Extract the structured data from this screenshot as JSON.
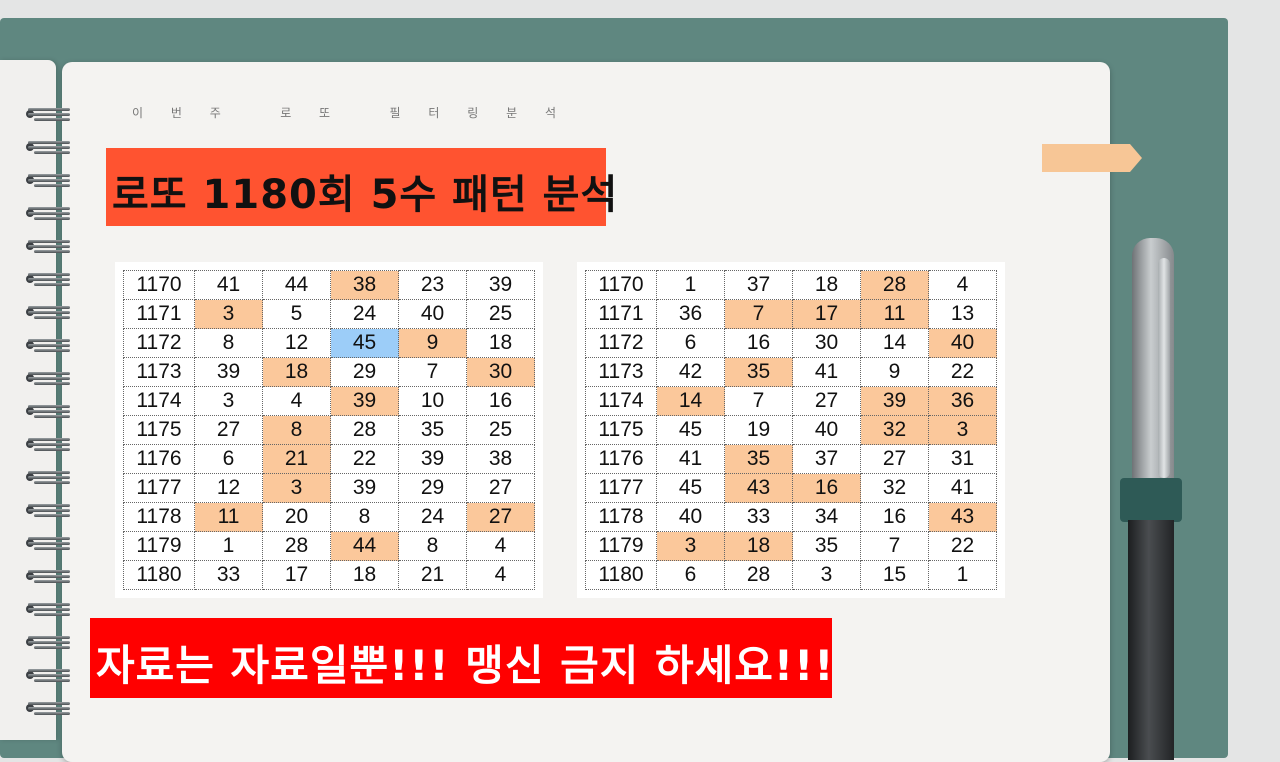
{
  "subtitle": "이 번 주   로 또   필 터 링 분 석",
  "title": "로또 1180회 5수 패턴 분석",
  "warning": "자료는 자료일뿐!!! 맹신 금지 하세요!!!",
  "colors": {
    "highlight": "#fbc89b",
    "blue_highlight": "#9ccdf8",
    "title_bg": "#ff5330",
    "warning_bg": "#ff0000"
  },
  "tables": [
    {
      "rows": [
        {
          "round": "1170",
          "nums": [
            "41",
            "44",
            "38",
            "23",
            "39"
          ],
          "hl": [
            2
          ]
        },
        {
          "round": "1171",
          "nums": [
            "3",
            "5",
            "24",
            "40",
            "25"
          ],
          "hl": [
            0
          ]
        },
        {
          "round": "1172",
          "nums": [
            "8",
            "12",
            "45",
            "9",
            "18"
          ],
          "hl": [
            3
          ],
          "blue": [
            2
          ]
        },
        {
          "round": "1173",
          "nums": [
            "39",
            "18",
            "29",
            "7",
            "30"
          ],
          "hl": [
            1,
            4
          ]
        },
        {
          "round": "1174",
          "nums": [
            "3",
            "4",
            "39",
            "10",
            "16"
          ],
          "hl": [
            2
          ]
        },
        {
          "round": "1175",
          "nums": [
            "27",
            "8",
            "28",
            "35",
            "25"
          ],
          "hl": [
            1
          ]
        },
        {
          "round": "1176",
          "nums": [
            "6",
            "21",
            "22",
            "39",
            "38"
          ],
          "hl": [
            1
          ]
        },
        {
          "round": "1177",
          "nums": [
            "12",
            "3",
            "39",
            "29",
            "27"
          ],
          "hl": [
            1
          ]
        },
        {
          "round": "1178",
          "nums": [
            "11",
            "20",
            "8",
            "24",
            "27"
          ],
          "hl": [
            0,
            4
          ]
        },
        {
          "round": "1179",
          "nums": [
            "1",
            "28",
            "44",
            "8",
            "4"
          ],
          "hl": [
            2
          ]
        },
        {
          "round": "1180",
          "nums": [
            "33",
            "17",
            "18",
            "21",
            "4"
          ],
          "hl": []
        }
      ]
    },
    {
      "rows": [
        {
          "round": "1170",
          "nums": [
            "1",
            "37",
            "18",
            "28",
            "4"
          ],
          "hl": [
            3
          ]
        },
        {
          "round": "1171",
          "nums": [
            "36",
            "7",
            "17",
            "11",
            "13"
          ],
          "hl": [
            1,
            2,
            3
          ]
        },
        {
          "round": "1172",
          "nums": [
            "6",
            "16",
            "30",
            "14",
            "40"
          ],
          "hl": [
            4
          ]
        },
        {
          "round": "1173",
          "nums": [
            "42",
            "35",
            "41",
            "9",
            "22"
          ],
          "hl": [
            1
          ]
        },
        {
          "round": "1174",
          "nums": [
            "14",
            "7",
            "27",
            "39",
            "36"
          ],
          "hl": [
            0,
            3,
            4
          ]
        },
        {
          "round": "1175",
          "nums": [
            "45",
            "19",
            "40",
            "32",
            "3"
          ],
          "hl": [
            3,
            4
          ]
        },
        {
          "round": "1176",
          "nums": [
            "41",
            "35",
            "37",
            "27",
            "31"
          ],
          "hl": [
            1
          ]
        },
        {
          "round": "1177",
          "nums": [
            "45",
            "43",
            "16",
            "32",
            "41"
          ],
          "hl": [
            1,
            2
          ]
        },
        {
          "round": "1178",
          "nums": [
            "40",
            "33",
            "34",
            "16",
            "43"
          ],
          "hl": [
            4
          ]
        },
        {
          "round": "1179",
          "nums": [
            "3",
            "18",
            "35",
            "7",
            "22"
          ],
          "hl": [
            0,
            1
          ]
        },
        {
          "round": "1180",
          "nums": [
            "6",
            "28",
            "3",
            "15",
            "1"
          ],
          "hl": []
        }
      ]
    }
  ]
}
